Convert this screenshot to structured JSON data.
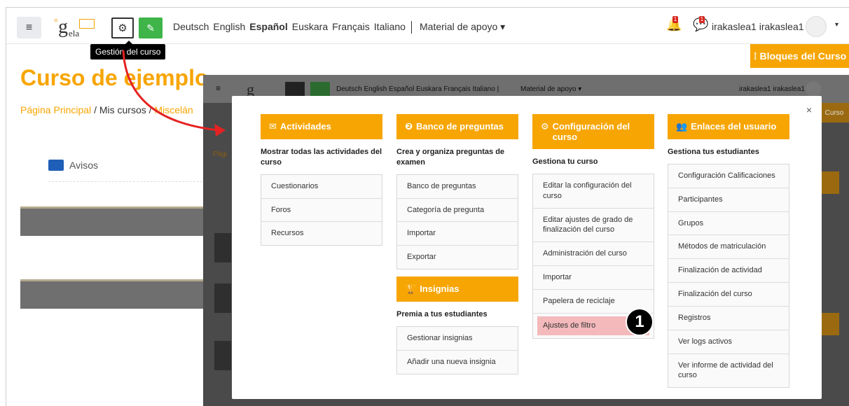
{
  "navbar": {
    "logo": {
      "mark": "g",
      "sub": "ela"
    },
    "languages": [
      {
        "label": "Deutsch",
        "active": false
      },
      {
        "label": "English",
        "active": false
      },
      {
        "label": "Español",
        "active": true
      },
      {
        "label": "Euskara",
        "active": false
      },
      {
        "label": "Français",
        "active": false
      },
      {
        "label": "Italiano",
        "active": false
      }
    ],
    "support_menu": "Material de apoyo ▾",
    "user_name": "irakaslea1 irakaslea1",
    "bell_count": "1",
    "message_count": "1",
    "user_caret": "▾"
  },
  "tooltip": "Gestión del curso",
  "blocks_button": "Bloques del Curso",
  "page_title": "Curso de ejemplo",
  "breadcrumb": {
    "home": "Página Principal",
    "sep": "/",
    "courses": "Mis cursos",
    "misc": "Miscelán"
  },
  "avisos_label": "Avisos",
  "overlay": {
    "languages": "Deutsch  English  Español  Euskara  Français  Italiano |",
    "support_menu": "Material de apoyo ▾",
    "user_name": "irakaslea1 irakaslea1",
    "blocks_short": "Curso",
    "breadcrumb_short": "Pági"
  },
  "modal": {
    "close": "×",
    "columns": [
      {
        "title": "Actividades",
        "icon": "✉",
        "description": "Mostrar todas las actividades del curso",
        "items": [
          "Cuestionarios",
          "Foros",
          "Recursos"
        ]
      },
      {
        "title": "Banco de preguntas",
        "icon": "❷",
        "description": "Crea y organiza preguntas de examen",
        "items": [
          "Banco de preguntas",
          "Categoría de pregunta",
          "Importar",
          "Exportar"
        ],
        "sub": {
          "title": "Insignias",
          "icon": "🏆",
          "description": "Premia a tus estudiantes",
          "items": [
            "Gestionar insignias",
            "Añadir una nueva insignia"
          ]
        }
      },
      {
        "title": "Configuración del curso",
        "icon": "⚙",
        "description": "Gestiona tu curso",
        "items": [
          "Editar la configuración del curso",
          "Editar ajustes de grado de finalización del curso",
          "Administración del curso",
          "Importar",
          "Papelera de reciclaje",
          "Ajustes de filtro"
        ]
      },
      {
        "title": "Enlaces del usuario",
        "icon": "👥",
        "description": "Gestiona tus estudiantes",
        "items": [
          "Configuración Calificaciones",
          "Participantes",
          "Grupos",
          "Métodos de matriculación",
          "Finalización de actividad",
          "Finalización del curso",
          "Registros",
          "Ver logs activos",
          "Ver informe de actividad del curso"
        ]
      }
    ]
  },
  "callout_number": "1",
  "colors": {
    "accent": "#f7a502",
    "edit_green": "#3fb449",
    "highlight": "#f4b9bb",
    "arrow": "#e52222"
  }
}
